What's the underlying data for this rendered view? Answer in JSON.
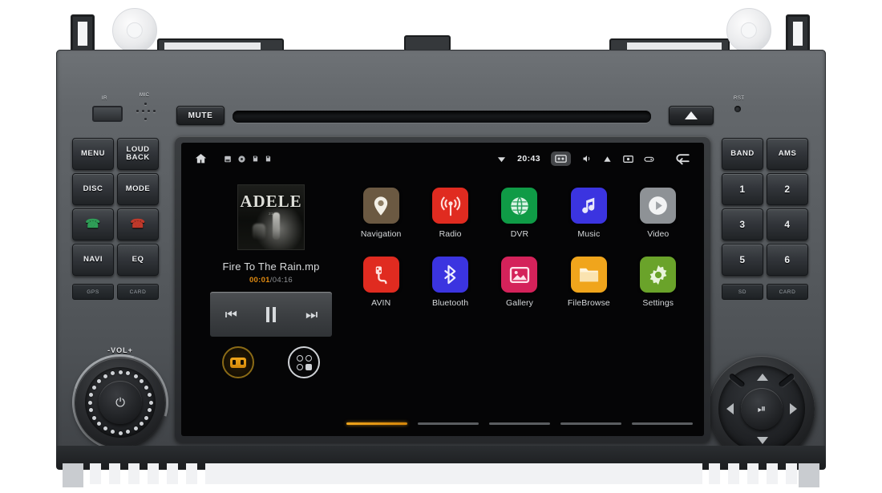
{
  "device": {
    "name": "car-head-unit",
    "top_controls": {
      "ir_label": "IR",
      "mic_label": "MIC",
      "mute_label": "MUTE",
      "eject_label": "eject-icon",
      "reset_label": "RST"
    },
    "left_keypad": [
      {
        "label": "MENU",
        "name": "menu-key"
      },
      {
        "label": "LOUD\nBACK",
        "line1": "LOUD",
        "line2": "BACK",
        "name": "loud-back-key"
      },
      {
        "label": "DISC",
        "name": "disc-key"
      },
      {
        "label": "MODE",
        "name": "mode-key"
      },
      {
        "label": "",
        "name": "call-answer-key"
      },
      {
        "label": "",
        "name": "call-end-key"
      },
      {
        "label": "NAVI",
        "name": "navi-key"
      },
      {
        "label": "EQ",
        "name": "eq-key"
      }
    ],
    "left_slots": [
      {
        "label": "GPS",
        "name": "gps-slot"
      },
      {
        "label": "CARD",
        "name": "card-slot-left"
      }
    ],
    "right_keypad": [
      {
        "label": "BAND",
        "name": "band-key"
      },
      {
        "label": "AMS",
        "name": "ams-key"
      },
      {
        "label": "1",
        "name": "preset-1-key"
      },
      {
        "label": "2",
        "name": "preset-2-key"
      },
      {
        "label": "3",
        "name": "preset-3-key"
      },
      {
        "label": "4",
        "name": "preset-4-key"
      },
      {
        "label": "5",
        "name": "preset-5-key"
      },
      {
        "label": "6",
        "name": "preset-6-key"
      }
    ],
    "right_slots": [
      {
        "label": "SD",
        "name": "sd-slot"
      },
      {
        "label": "CARD",
        "name": "card-slot-right"
      }
    ],
    "volume_knob": {
      "label": "-VOL+",
      "power_glyph": "⏻"
    },
    "dpad": {
      "center_glyph": "⏯"
    }
  },
  "screen": {
    "statusbar": {
      "home_icon": "home-icon",
      "left_icons": [
        "sd-card-icon",
        "disc-icon",
        "storage-icon",
        "storage-alt-icon"
      ],
      "wifi_icon": "wifi-icon",
      "time": "20:43",
      "right_icons": [
        "screenshot-icon",
        "volume-icon",
        "alert-icon",
        "camera-icon",
        "ir-remote-icon"
      ],
      "back_icon": "back-arrow-icon"
    },
    "music_widget": {
      "album_art_text": "ADELE",
      "album_art_subtitle": "21",
      "track_title": "Fire To The Rain.mp",
      "time_current": "00:01",
      "time_separator": "/",
      "time_duration": "04:16",
      "prev_icon": "previous-track-icon",
      "pause_icon": "pause-icon",
      "next_icon": "next-track-icon",
      "shortcut_car_icon": "car-mode-icon",
      "shortcut_apps_icon": "all-apps-icon"
    },
    "apps": [
      {
        "label": "Navigation",
        "icon": "map-pin-icon",
        "color": "#6b5942",
        "name": "app-navigation"
      },
      {
        "label": "Radio",
        "icon": "radio-tower-icon",
        "color": "#e02b20",
        "name": "app-radio"
      },
      {
        "label": "DVR",
        "icon": "globe-icon",
        "color": "#0f9b46",
        "name": "app-dvr"
      },
      {
        "label": "Music",
        "icon": "music-note-icon",
        "color": "#3b34e0",
        "name": "app-music"
      },
      {
        "label": "Video",
        "icon": "play-circle-icon",
        "color": "#8e9296",
        "name": "app-video"
      },
      {
        "label": "AVIN",
        "icon": "av-plug-icon",
        "color": "#e02b20",
        "name": "app-avin"
      },
      {
        "label": "Bluetooth",
        "icon": "bluetooth-icon",
        "color": "#3b34e0",
        "name": "app-bluetooth"
      },
      {
        "label": "Gallery",
        "icon": "photo-icon",
        "color": "#d4225a",
        "name": "app-gallery"
      },
      {
        "label": "FileBrowse",
        "icon": "folder-icon",
        "color": "#f0a51c",
        "name": "app-filebrowse"
      },
      {
        "label": "Settings",
        "icon": "gear-icon",
        "color": "#6aa32a",
        "name": "app-settings"
      }
    ],
    "pager": {
      "count": 5,
      "active_index": 0
    },
    "accent_color": "#f0a51c"
  }
}
